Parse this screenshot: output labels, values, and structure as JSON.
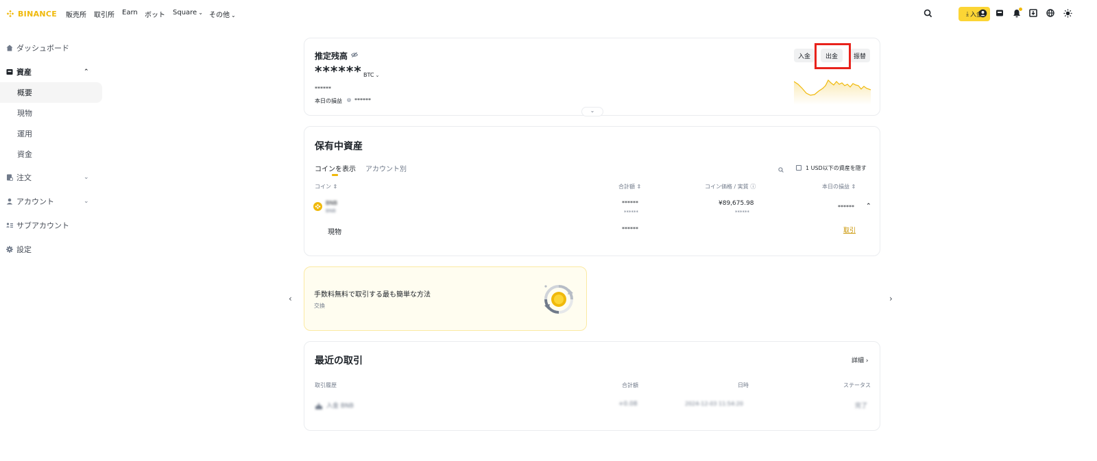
{
  "nav": {
    "logo": "BINANCE",
    "items": [
      "販売所",
      "取引所",
      "Earn",
      "ボット",
      "Square",
      "その他"
    ],
    "deposit_label": "入金",
    "colors": {
      "brand": "#f0b90b",
      "deposit_bg": "#fcd535"
    },
    "right_icons": [
      "search-icon",
      "user-icon",
      "wallet-icon",
      "bell-icon",
      "download-app-icon",
      "globe-icon",
      "theme-icon"
    ]
  },
  "sidebar": {
    "items": [
      {
        "label": "ダッシュボード",
        "icon": "home-icon"
      },
      {
        "label": "資産",
        "icon": "wallet-icon"
      },
      {
        "label": "注文",
        "icon": "orders-icon"
      },
      {
        "label": "アカウント",
        "icon": "user-icon"
      },
      {
        "label": "サブアカウント",
        "icon": "sub-account-icon"
      },
      {
        "label": "設定",
        "icon": "settings-icon"
      }
    ],
    "sub_items": [
      "概要",
      "現物",
      "運用",
      "資金"
    ]
  },
  "balance": {
    "title": "推定残高",
    "amount": "******",
    "unit": "BTC",
    "fiat": "******",
    "pnl_label": "本日の損益",
    "pnl_value": "******",
    "buttons": [
      "入金",
      "出金",
      "振替"
    ],
    "sparkline_color": "#f0b90b"
  },
  "holdings": {
    "title": "保有中資産",
    "tabs": [
      "コインを表示",
      "アカウント別"
    ],
    "hide_small": "1 USD以下の資産を隠す",
    "columns": [
      "コイン",
      "合計額",
      "コイン価格 / 実質",
      "本日の損益"
    ],
    "row": {
      "coin": "BNB",
      "coin_sub": "BNB",
      "total": "******",
      "total_sub": "******",
      "price": "¥89,675.98",
      "price_sub": "******",
      "pnl": "******"
    },
    "sub_row": {
      "label": "現物",
      "total": "******",
      "action": "取引"
    }
  },
  "promo": {
    "title": "手数料無料で取引する最も簡単な方法",
    "subtitle": "交換"
  },
  "recent": {
    "title": "最近の取引",
    "details": "詳細",
    "columns": [
      "取引履歴",
      "合計額",
      "日時",
      "ステータス"
    ],
    "row": {
      "type": "入金 BNB",
      "amount": "+0.08",
      "datetime": "2024-12-03 11:54:20",
      "status": "完了"
    }
  }
}
